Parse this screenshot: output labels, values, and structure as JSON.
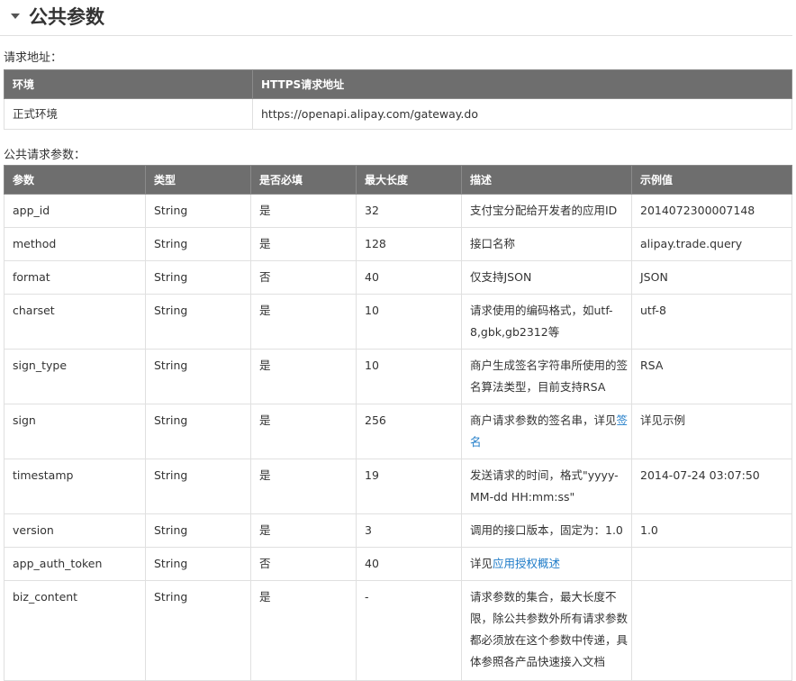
{
  "section": {
    "title": "公共参数"
  },
  "request_address": {
    "label": "请求地址：",
    "headers": [
      "环境",
      "HTTPS请求地址"
    ],
    "rows": [
      {
        "env": "正式环境",
        "url": "https://openapi.alipay.com/gateway.do"
      }
    ]
  },
  "public_params": {
    "label": "公共请求参数：",
    "headers": [
      "参数",
      "类型",
      "是否必填",
      "最大长度",
      "描述",
      "示例值"
    ],
    "rows": [
      {
        "param": "app_id",
        "type": "String",
        "required": "是",
        "max_len": "32",
        "desc": "支付宝分配给开发者的应用ID",
        "link": "",
        "desc_after": "",
        "example": "2014072300007148"
      },
      {
        "param": "method",
        "type": "String",
        "required": "是",
        "max_len": "128",
        "desc": "接口名称",
        "link": "",
        "desc_after": "",
        "example": "alipay.trade.query"
      },
      {
        "param": "format",
        "type": "String",
        "required": "否",
        "max_len": "40",
        "desc": "仅支持JSON",
        "link": "",
        "desc_after": "",
        "example": "JSON"
      },
      {
        "param": "charset",
        "type": "String",
        "required": "是",
        "max_len": "10",
        "desc": "请求使用的编码格式，如utf-8,gbk,gb2312等",
        "link": "",
        "desc_after": "",
        "example": "utf-8"
      },
      {
        "param": "sign_type",
        "type": "String",
        "required": "是",
        "max_len": "10",
        "desc": "商户生成签名字符串所使用的签名算法类型，目前支持RSA",
        "link": "",
        "desc_after": "",
        "example": "RSA"
      },
      {
        "param": "sign",
        "type": "String",
        "required": "是",
        "max_len": "256",
        "desc": "商户请求参数的签名串，详见",
        "link": "签名",
        "desc_after": "",
        "example": "详见示例"
      },
      {
        "param": "timestamp",
        "type": "String",
        "required": "是",
        "max_len": "19",
        "desc": "发送请求的时间，格式\"yyyy-MM-dd HH:mm:ss\"",
        "link": "",
        "desc_after": "",
        "example": "2014-07-24 03:07:50"
      },
      {
        "param": "version",
        "type": "String",
        "required": "是",
        "max_len": "3",
        "desc": "调用的接口版本，固定为：1.0",
        "link": "",
        "desc_after": "",
        "example": "1.0"
      },
      {
        "param": "app_auth_token",
        "type": "String",
        "required": "否",
        "max_len": "40",
        "desc": "详见",
        "link": "应用授权概述",
        "desc_after": "",
        "example": ""
      },
      {
        "param": "biz_content",
        "type": "String",
        "required": "是",
        "max_len": "-",
        "desc": "请求参数的集合，最大长度不限，除公共参数外所有请求参数都必须放在这个参数中传递，具体参照各产品快速接入文档",
        "link": "",
        "desc_after": "",
        "example": ""
      }
    ]
  },
  "colors": {
    "header_bg": "#6e6e6e",
    "link": "#1e7bc8",
    "border": "#e0e0e0"
  }
}
